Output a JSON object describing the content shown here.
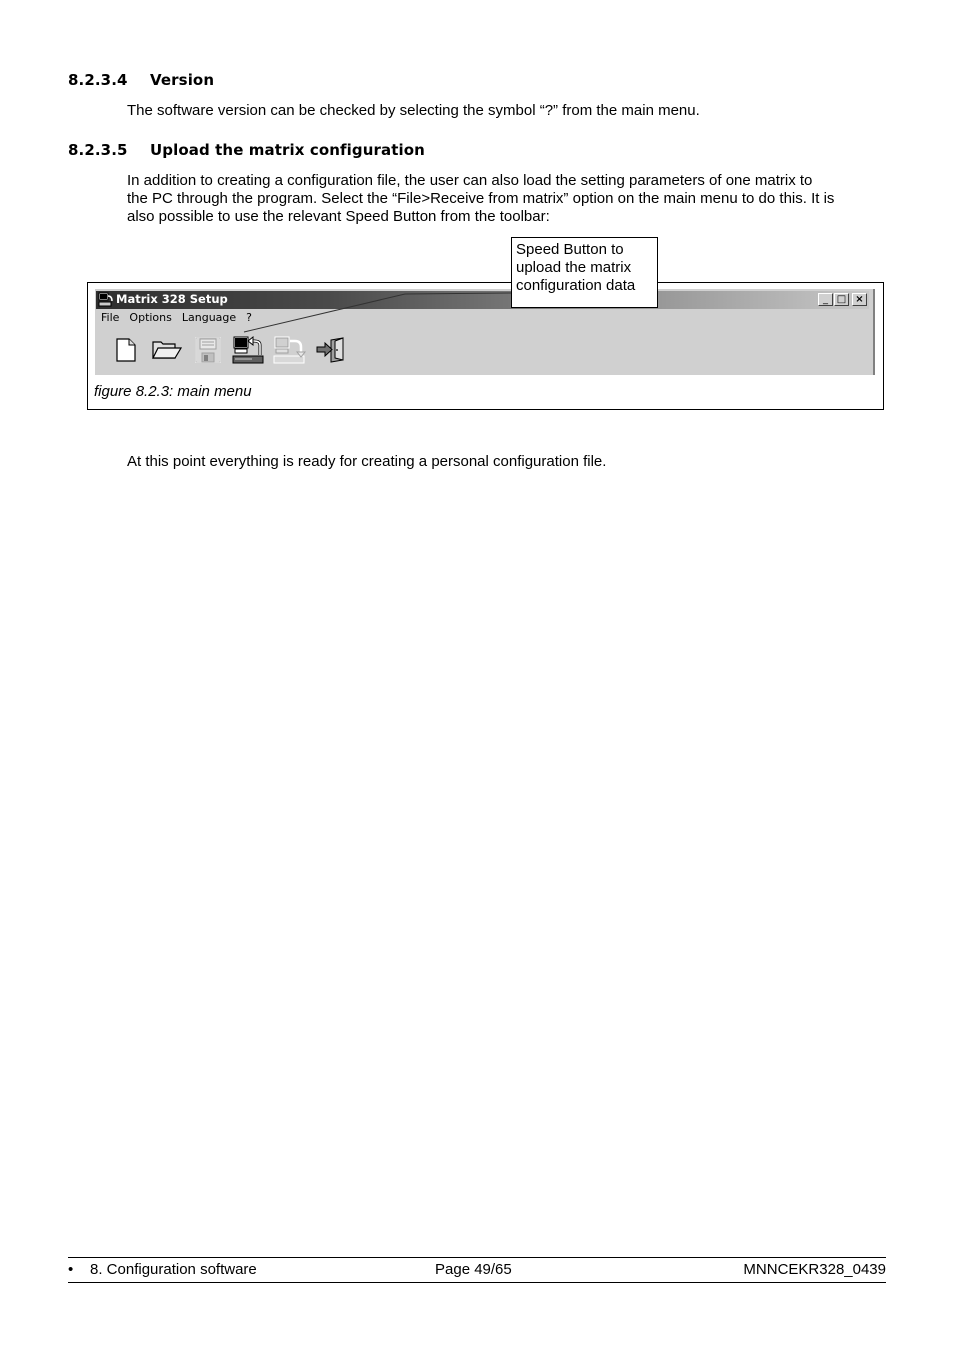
{
  "sections": [
    {
      "number": "8.2.3.4",
      "title": "Version",
      "paragraphs": [
        "The software version can be checked by selecting the symbol “?” from the main menu."
      ]
    },
    {
      "number": "8.2.3.5",
      "title": "Upload the matrix configuration",
      "paragraphs": [
        "In addition to creating a configuration file, the user can also load the setting parameters of one matrix to",
        "the PC through the program. Select the “File>Receive from matrix” option on the main menu to do this. It is",
        "also possible to use the relevant Speed Button from the toolbar:"
      ]
    }
  ],
  "figure": {
    "window_title": "Matrix 328 Setup",
    "window_buttons": {
      "minimize": "_",
      "maximize": "□",
      "close": "×"
    },
    "menu": [
      "File",
      "Options",
      "Language",
      "?"
    ],
    "toolbar": [
      {
        "icon": "new-file-icon",
        "enabled": true
      },
      {
        "icon": "open-folder-icon",
        "enabled": true
      },
      {
        "icon": "save-disk-icon",
        "enabled": false
      },
      {
        "icon": "receive-from-matrix-icon",
        "enabled": true
      },
      {
        "icon": "send-to-matrix-icon",
        "enabled": false
      },
      {
        "icon": "exit-door-icon",
        "enabled": true
      }
    ],
    "callout_lines": [
      "Speed Button to",
      "upload the matrix",
      "configuration data"
    ],
    "caption": "figure 8.2.3: main menu"
  },
  "closing_text": "At this point everything is ready for creating a personal configuration file.",
  "footer": {
    "bullet": "•",
    "chapter": "8. Configuration software",
    "page": "Page 49/65",
    "doc_code": "MNNCEKR328_0439"
  }
}
